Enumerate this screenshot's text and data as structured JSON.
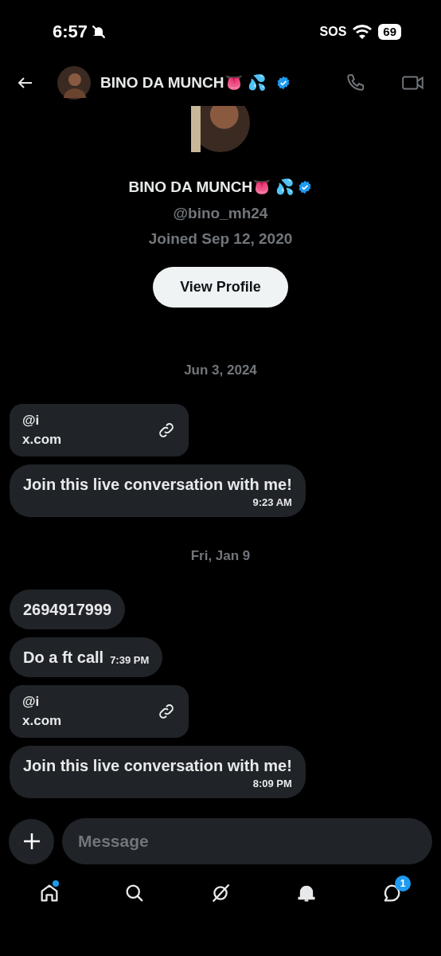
{
  "status_bar": {
    "time": "6:57",
    "muted": true,
    "carrier": "SOS",
    "battery": "69"
  },
  "header": {
    "name": "BINO DA MUNCH👅 💦",
    "verified": true
  },
  "profile": {
    "name": "BINO DA MUNCH👅 💦",
    "verified": true,
    "handle": "@bino_mh24",
    "joined": "Joined Sep 12, 2020",
    "button": "View Profile"
  },
  "messages": [
    {
      "kind": "date",
      "text": "Jun 3, 2024"
    },
    {
      "kind": "link",
      "handle": "@i",
      "domain": "x.com"
    },
    {
      "kind": "text",
      "text": "Join this live conversation with me!",
      "time": "9:23 AM",
      "time_below": true
    },
    {
      "kind": "date",
      "text": "Fri, Jan 9"
    },
    {
      "kind": "text",
      "text": "2694917999"
    },
    {
      "kind": "text",
      "text": "Do a ft call",
      "time": "7:39 PM",
      "time_below": false
    },
    {
      "kind": "link",
      "handle": "@i",
      "domain": "x.com"
    },
    {
      "kind": "text",
      "text": "Join this live conversation with me!",
      "time": "8:09 PM",
      "time_below": true
    }
  ],
  "composer": {
    "placeholder": "Message"
  },
  "nav": [
    {
      "kind": "home",
      "dot": true
    },
    {
      "kind": "search",
      "dot": false
    },
    {
      "kind": "grok",
      "dot": false
    },
    {
      "kind": "notifications",
      "dot": false
    },
    {
      "kind": "messages",
      "dot": false,
      "badge": "1"
    }
  ]
}
